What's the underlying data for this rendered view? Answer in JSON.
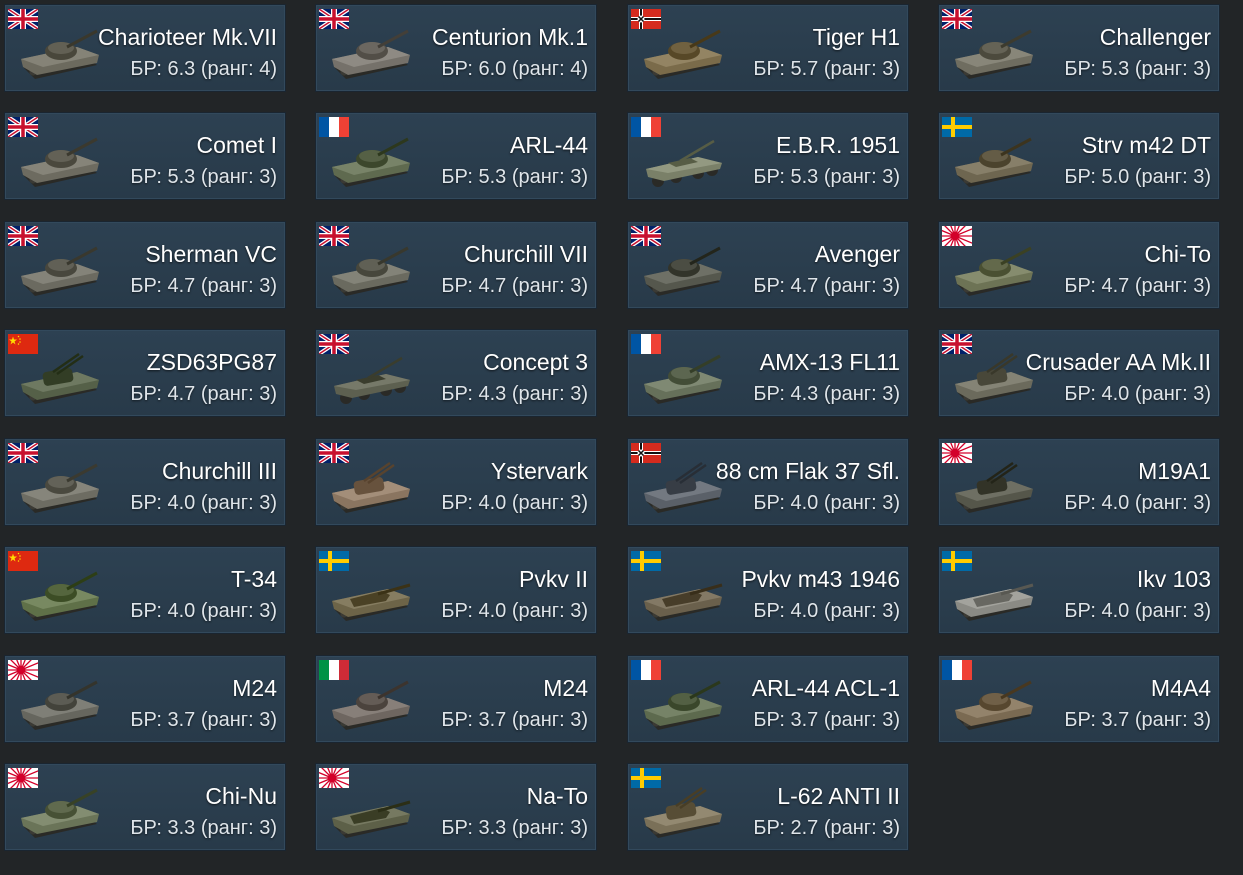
{
  "colors": {
    "page_background": "#222527",
    "card_background": "#2b3f4f",
    "name_text": "#ffffff",
    "br_text": "#dfe5ea"
  },
  "vehicles": [
    {
      "name": "Charioteer Mk.VII",
      "br": "БР: 6.3 (ранг: 4)",
      "nation": "uk",
      "icon": "tank-icon",
      "hull": "#6c6a5e"
    },
    {
      "name": "Centurion Mk.1",
      "br": "БР: 6.0 (ранг: 4)",
      "nation": "uk",
      "icon": "tank-icon",
      "hull": "#75716a"
    },
    {
      "name": "Tiger H1",
      "br": "БР: 5.7 (ранг: 3)",
      "nation": "germany",
      "icon": "tank-icon",
      "hull": "#7a6b4a"
    },
    {
      "name": "Challenger",
      "br": "БР: 5.3 (ранг: 3)",
      "nation": "uk",
      "icon": "tank-icon",
      "hull": "#6f6d60"
    },
    {
      "name": "Comet I",
      "br": "БР: 5.3 (ранг: 3)",
      "nation": "uk",
      "icon": "tank-icon",
      "hull": "#6d6b60"
    },
    {
      "name": "ARL-44",
      "br": "БР: 5.3 (ранг: 3)",
      "nation": "france",
      "icon": "tank-icon",
      "hull": "#5f6a4f"
    },
    {
      "name": "E.B.R. 1951",
      "br": "БР: 5.3 (ранг: 3)",
      "nation": "france",
      "icon": "armored-car-icon",
      "hull": "#7a8068"
    },
    {
      "name": "Strv m42 DT",
      "br": "БР: 5.0 (ранг: 3)",
      "nation": "sweden",
      "icon": "tank-icon",
      "hull": "#6e6650"
    },
    {
      "name": "Sherman VC",
      "br": "БР: 4.7 (ранг: 3)",
      "nation": "uk",
      "icon": "tank-icon",
      "hull": "#6b6a60"
    },
    {
      "name": "Churchill VII",
      "br": "БР: 4.7 (ранг: 3)",
      "nation": "uk",
      "icon": "tank-icon",
      "hull": "#6a6a5f"
    },
    {
      "name": "Avenger",
      "br": "БР: 4.7 (ранг: 3)",
      "nation": "uk",
      "icon": "tank-icon",
      "hull": "#55574d"
    },
    {
      "name": "Chi-To",
      "br": "БР: 4.7 (ранг: 3)",
      "nation": "japan",
      "icon": "tank-icon",
      "hull": "#6d7355"
    },
    {
      "name": "ZSD63PG87",
      "br": "БР: 4.7 (ранг: 3)",
      "nation": "china",
      "icon": "spaa-icon",
      "hull": "#556048"
    },
    {
      "name": "Concept 3",
      "br": "БР: 4.3 (ранг: 3)",
      "nation": "uk",
      "icon": "armored-car-icon",
      "hull": "#5d6050"
    },
    {
      "name": "AMX-13 FL11",
      "br": "БР: 4.3 (ранг: 3)",
      "nation": "france",
      "icon": "tank-icon",
      "hull": "#66705a"
    },
    {
      "name": "Crusader AA Mk.II",
      "br": "БР: 4.0 (ранг: 3)",
      "nation": "uk",
      "icon": "spaa-icon",
      "hull": "#6b6a5c"
    },
    {
      "name": "Churchill III",
      "br": "БР: 4.0 (ранг: 3)",
      "nation": "uk",
      "icon": "tank-icon",
      "hull": "#6d6c62"
    },
    {
      "name": "Ystervark",
      "br": "БР: 4.0 (ранг: 3)",
      "nation": "uk",
      "icon": "spaa-icon",
      "hull": "#8a7560"
    },
    {
      "name": "88 cm Flak 37 Sfl.",
      "br": "БР: 4.0 (ранг: 3)",
      "nation": "germany",
      "icon": "spaa-icon",
      "hull": "#5a6068"
    },
    {
      "name": "M19A1",
      "br": "БР: 4.0 (ранг: 3)",
      "nation": "japan",
      "icon": "spaa-icon",
      "hull": "#55564a"
    },
    {
      "name": "T-34",
      "br": "БР: 4.0 (ранг: 3)",
      "nation": "china",
      "icon": "tank-icon",
      "hull": "#5f7048"
    },
    {
      "name": "Pvkv II",
      "br": "БР: 4.0 (ранг: 3)",
      "nation": "sweden",
      "icon": "tank-destroyer-icon",
      "hull": "#6d6448"
    },
    {
      "name": "Pvkv m43 1946",
      "br": "БР: 4.0 (ранг: 3)",
      "nation": "sweden",
      "icon": "tank-destroyer-icon",
      "hull": "#6a604c"
    },
    {
      "name": "Ikv 103",
      "br": "БР: 4.0 (ранг: 3)",
      "nation": "sweden",
      "icon": "tank-destroyer-icon",
      "hull": "#8a8a84"
    },
    {
      "name": "M24",
      "br": "БР: 3.7 (ранг: 3)",
      "nation": "japan",
      "icon": "tank-icon",
      "hull": "#66665e"
    },
    {
      "name": "M24",
      "br": "БР: 3.7 (ранг: 3)",
      "nation": "italy",
      "icon": "tank-icon",
      "hull": "#6e6660"
    },
    {
      "name": "ARL-44 ACL-1",
      "br": "БР: 3.7 (ранг: 3)",
      "nation": "france",
      "icon": "tank-icon",
      "hull": "#5d6a4e"
    },
    {
      "name": "M4A4",
      "br": "БР: 3.7 (ранг: 3)",
      "nation": "france",
      "icon": "tank-icon",
      "hull": "#7a6a52"
    },
    {
      "name": "Chi-Nu",
      "br": "БР: 3.3 (ранг: 3)",
      "nation": "japan",
      "icon": "tank-icon",
      "hull": "#6a7458"
    },
    {
      "name": "Na-To",
      "br": "БР: 3.3 (ранг: 3)",
      "nation": "japan",
      "icon": "tank-destroyer-icon",
      "hull": "#5d6048"
    },
    {
      "name": "L-62 ANTI II",
      "br": "БР: 2.7 (ранг: 3)",
      "nation": "sweden",
      "icon": "spaa-icon",
      "hull": "#7a7058"
    }
  ]
}
